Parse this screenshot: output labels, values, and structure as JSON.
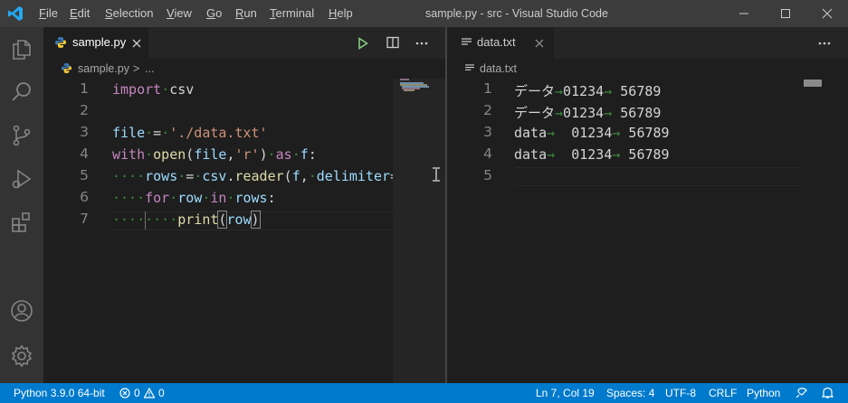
{
  "menu": [
    "File",
    "Edit",
    "Selection",
    "View",
    "Go",
    "Run",
    "Terminal",
    "Help"
  ],
  "window_title": "sample.py - src - Visual Studio Code",
  "left_editor": {
    "tab_label": "sample.py",
    "breadcrumb": {
      "file": "sample.py",
      "sep": ">",
      "rest": "..."
    },
    "lines": [
      {
        "n": "1",
        "segments": [
          [
            "kw",
            "import"
          ],
          [
            "ws",
            "·"
          ],
          [
            "pl",
            "csv"
          ]
        ]
      },
      {
        "n": "2",
        "segments": []
      },
      {
        "n": "3",
        "segments": [
          [
            "var",
            "file"
          ],
          [
            "ws",
            "·"
          ],
          [
            "pl",
            "="
          ],
          [
            "ws",
            "·"
          ],
          [
            "str",
            "'./data.txt'"
          ]
        ]
      },
      {
        "n": "4",
        "segments": [
          [
            "kw",
            "with"
          ],
          [
            "ws",
            "·"
          ],
          [
            "fn",
            "open"
          ],
          [
            "pl",
            "("
          ],
          [
            "var",
            "file"
          ],
          [
            "pl",
            ","
          ],
          [
            "str",
            "'r'"
          ],
          [
            "pl",
            ")"
          ],
          [
            "ws",
            "·"
          ],
          [
            "kw",
            "as"
          ],
          [
            "ws",
            "·"
          ],
          [
            "var",
            "f"
          ],
          [
            "pl",
            ":"
          ]
        ]
      },
      {
        "n": "5",
        "segments": [
          [
            "ws",
            "····"
          ],
          [
            "var",
            "rows"
          ],
          [
            "ws",
            "·"
          ],
          [
            "pl",
            "="
          ],
          [
            "ws",
            "·"
          ],
          [
            "var",
            "csv"
          ],
          [
            "pl",
            "."
          ],
          [
            "fn",
            "reader"
          ],
          [
            "pl",
            "("
          ],
          [
            "var",
            "f"
          ],
          [
            "pl",
            ","
          ],
          [
            "ws",
            "·"
          ],
          [
            "var",
            "delimiter"
          ],
          [
            "pl",
            "="
          ]
        ]
      },
      {
        "n": "6",
        "segments": [
          [
            "ws",
            "····"
          ],
          [
            "kw",
            "for"
          ],
          [
            "ws",
            "·"
          ],
          [
            "var",
            "row"
          ],
          [
            "ws",
            "·"
          ],
          [
            "kw",
            "in"
          ],
          [
            "ws",
            "·"
          ],
          [
            "var",
            "rows"
          ],
          [
            "pl",
            ":"
          ]
        ]
      },
      {
        "n": "7",
        "segments": [
          [
            "ws",
            "····"
          ],
          [
            "ws",
            "····"
          ],
          [
            "fn",
            "print"
          ],
          [
            "pr",
            "("
          ],
          [
            "var",
            "row"
          ],
          [
            "pr",
            ")"
          ]
        ]
      }
    ]
  },
  "right_editor": {
    "tab_label": "data.txt",
    "breadcrumb": "data.txt",
    "lines": [
      {
        "n": "1",
        "segments": [
          [
            "pl",
            "データ"
          ],
          [
            "ws",
            "→"
          ],
          [
            "pl",
            "01234"
          ],
          [
            "ws",
            "→"
          ],
          [
            "pl",
            " 56789"
          ]
        ]
      },
      {
        "n": "2",
        "segments": [
          [
            "pl",
            "データ"
          ],
          [
            "ws",
            "→"
          ],
          [
            "pl",
            "01234"
          ],
          [
            "ws",
            "→"
          ],
          [
            "pl",
            " 56789"
          ]
        ]
      },
      {
        "n": "3",
        "segments": [
          [
            "pl",
            "data"
          ],
          [
            "ws",
            "→"
          ],
          [
            "pl",
            "  01234"
          ],
          [
            "ws",
            "→"
          ],
          [
            "pl",
            " 56789"
          ]
        ]
      },
      {
        "n": "4",
        "segments": [
          [
            "pl",
            "data"
          ],
          [
            "ws",
            "→"
          ],
          [
            "pl",
            "  01234"
          ],
          [
            "ws",
            "→"
          ],
          [
            "pl",
            " 56789"
          ]
        ]
      },
      {
        "n": "5",
        "segments": []
      }
    ]
  },
  "status": {
    "python": "Python 3.9.0 64-bit",
    "errors": "0",
    "warnings": "0",
    "cursor": "Ln 7, Col 19",
    "spaces": "Spaces: 4",
    "encoding": "UTF-8",
    "eol": "CRLF",
    "language": "Python"
  },
  "colors": {
    "accent": "#007acc",
    "keyword": "#c586c0",
    "function": "#dcdcaa",
    "string": "#ce9178",
    "variable": "#9cdcfe",
    "whitespace": "#3b8a3b"
  },
  "icons": {
    "activity": [
      "explorer-icon",
      "search-icon",
      "source-control-icon",
      "run-debug-icon",
      "extensions-icon",
      "account-icon",
      "settings-gear-icon"
    ],
    "titlebar": [
      "vscode-logo-icon",
      "minimize-icon",
      "maximize-icon",
      "close-icon"
    ],
    "editor_actions": [
      "run-icon",
      "split-editor-icon",
      "more-actions-icon",
      "close-tab-icon"
    ]
  }
}
